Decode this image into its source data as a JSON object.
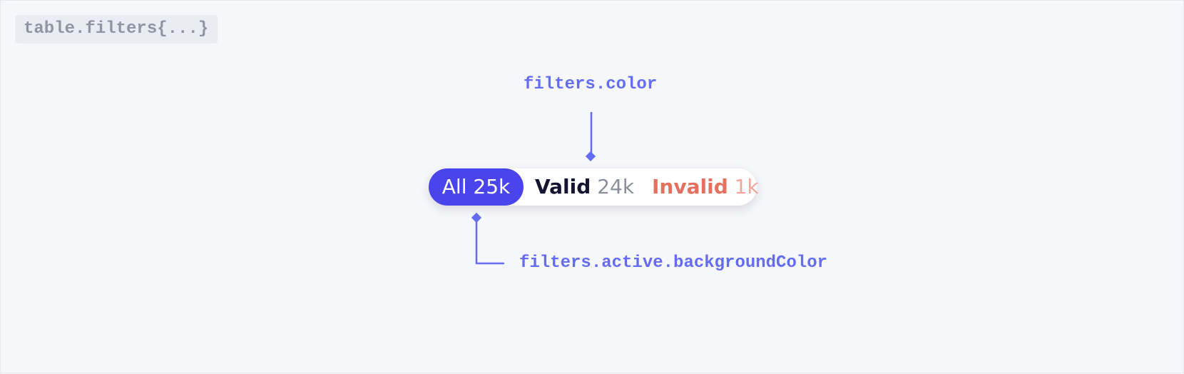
{
  "code_tag": "table.filters{...}",
  "annotations": {
    "top": "filters.color",
    "bottom": "filters.active.backgroundColor"
  },
  "filters": [
    {
      "label": "All",
      "count": "25k",
      "active": true
    },
    {
      "label": "Valid",
      "count": "24k",
      "active": false
    },
    {
      "label": "Invalid",
      "count": "1k",
      "active": false
    }
  ],
  "colors": {
    "active_background": "#4a44ec",
    "annotation": "#646cf2",
    "valid_text": "#121431",
    "invalid_text": "#e6705f",
    "page_background": "#f6f7fb"
  }
}
